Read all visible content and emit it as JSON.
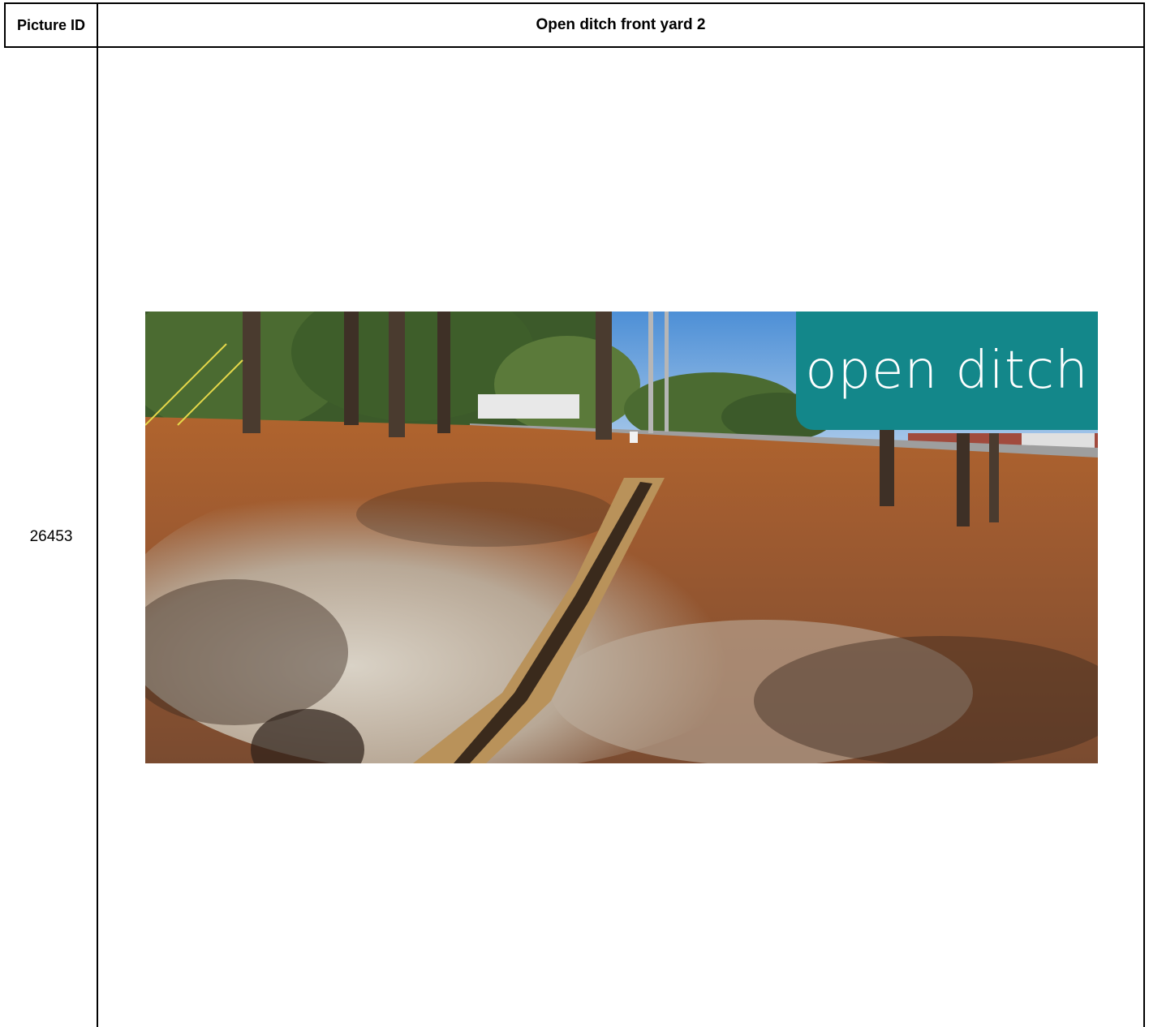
{
  "table": {
    "header_id": "Picture ID",
    "header_title": "Open ditch front yard 2",
    "rows": [
      {
        "id": "26453",
        "photo": {
          "caption": "open ditch",
          "caption_bg": "#13878a"
        }
      }
    ]
  }
}
